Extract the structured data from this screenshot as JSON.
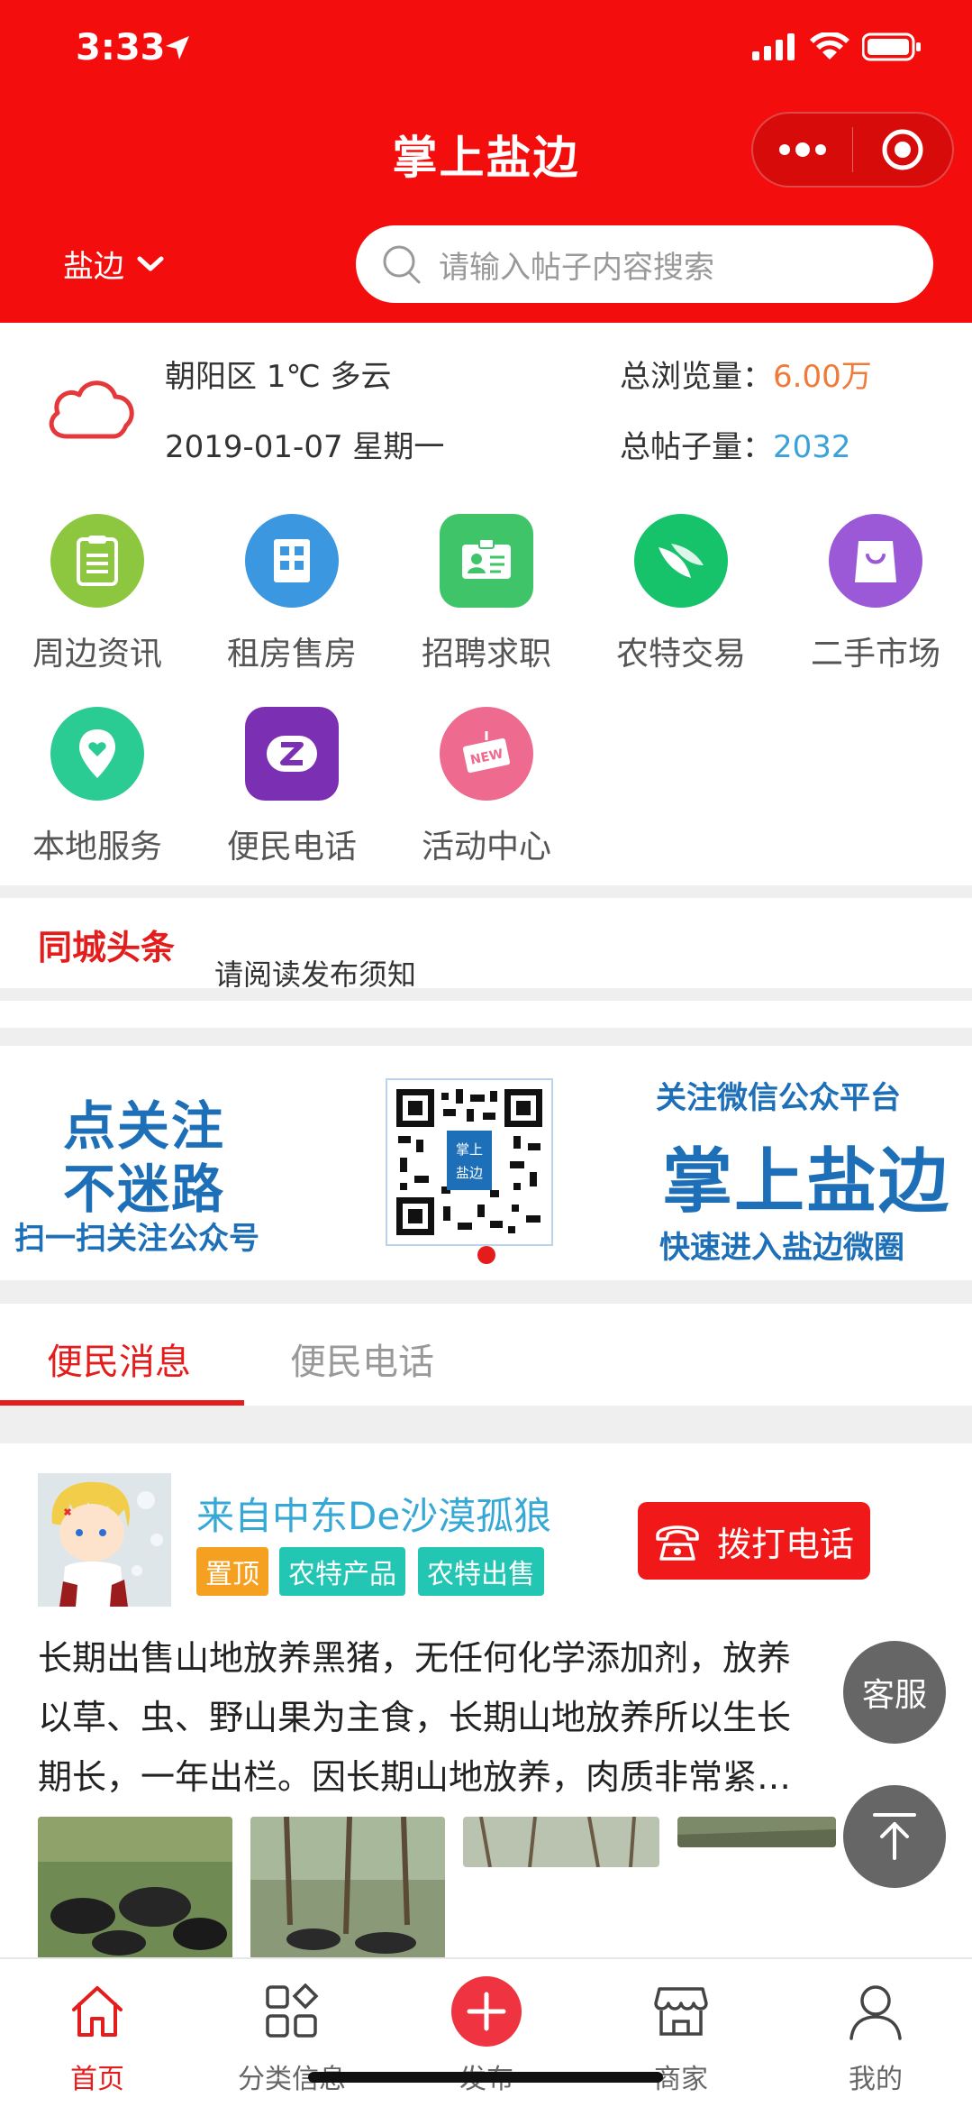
{
  "status": {
    "time": "3:33"
  },
  "header": {
    "title": "掌上盐边",
    "city": "盐边",
    "search_placeholder": "请输入帖子内容搜索"
  },
  "info": {
    "district": "朝阳区",
    "temp": "1℃",
    "weather": "多云",
    "date": "2019-01-07",
    "weekday": "星期一",
    "views_label": "总浏览量：",
    "views_value": "6.00万",
    "posts_label": "总帖子量：",
    "posts_value": "2032"
  },
  "categories": [
    {
      "label": "周边资讯",
      "color": "#8dc63f",
      "icon": "clipboard-icon"
    },
    {
      "label": "租房售房",
      "color": "#3a97e0",
      "icon": "building-icon"
    },
    {
      "label": "招聘求职",
      "color": "#3fc46a",
      "icon": "id-card-icon"
    },
    {
      "label": "农特交易",
      "color": "#16c26a",
      "icon": "leaf-icon"
    },
    {
      "label": "二手市场",
      "color": "#9b59d8",
      "icon": "shopping-bag-icon"
    },
    {
      "label": "本地服务",
      "color": "#2bcb94",
      "icon": "location-pin-icon"
    },
    {
      "label": "便民电话",
      "color": "#7b2fb2",
      "icon": "phone-app-icon"
    },
    {
      "label": "活动中心",
      "color": "#ee6a8e",
      "icon": "new-badge-icon"
    }
  ],
  "headline": {
    "title": "同城头条",
    "text": "请阅读发布须知"
  },
  "banner": {
    "left_line1": "点关注",
    "left_line2": "不迷路",
    "left_line3": "扫一扫关注公众号",
    "qr_text_top": "掌上",
    "qr_text_bottom": "盐边",
    "right_line1": "关注微信公众平台",
    "right_line2": "掌上盐边",
    "right_line3": "快速进入盐边微圈"
  },
  "tabs": [
    {
      "label": "便民消息",
      "active": true
    },
    {
      "label": "便民电话",
      "active": false
    }
  ],
  "post": {
    "user": "来自中东De沙漠孤狼",
    "tags": [
      {
        "label": "置顶",
        "color": "#f5a020"
      },
      {
        "label": "农特产品",
        "color": "#22c6b2"
      },
      {
        "label": "农特出售",
        "color": "#22c6b2"
      }
    ],
    "call_label": "拨打电话",
    "lines": [
      "长期出售山地放养黑猪，无任何化学添加剂，放养",
      "以草、虫、野山果为主食，长期山地放养所以生长",
      "期长，一年出栏。因长期山地放养，肉质非常紧…"
    ]
  },
  "floating": {
    "service_label": "客服"
  },
  "tabbar": [
    {
      "label": "首页",
      "active": true
    },
    {
      "label": "分类信息",
      "active": false
    },
    {
      "label": "发布",
      "active": false
    },
    {
      "label": "商家",
      "active": false
    },
    {
      "label": "我的",
      "active": false
    }
  ],
  "colors": {
    "brand_red": "#f40d0d",
    "accent_red": "#e51c1c",
    "banner_blue": "#1d6fb8"
  }
}
